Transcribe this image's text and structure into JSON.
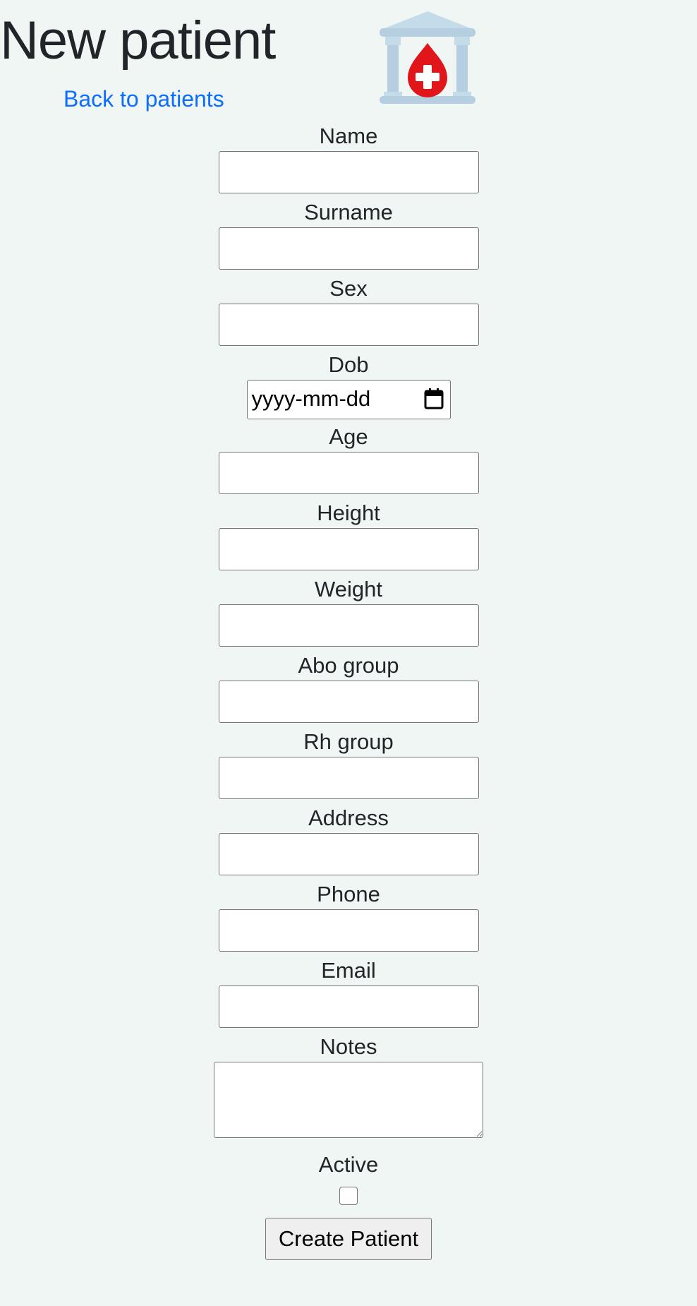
{
  "header": {
    "title": "New patient",
    "back_link": "Back to patients",
    "logo_icon": "blood-bank-icon"
  },
  "form": {
    "fields": [
      {
        "label": "Name",
        "value": ""
      },
      {
        "label": "Surname",
        "value": ""
      },
      {
        "label": "Sex",
        "value": ""
      },
      {
        "label": "Dob",
        "placeholder": "yyyy-mm-dd"
      },
      {
        "label": "Age",
        "value": ""
      },
      {
        "label": "Height",
        "value": ""
      },
      {
        "label": "Weight",
        "value": ""
      },
      {
        "label": "Abo group",
        "value": ""
      },
      {
        "label": "Rh group",
        "value": ""
      },
      {
        "label": "Address",
        "value": ""
      },
      {
        "label": "Phone",
        "value": ""
      },
      {
        "label": "Email",
        "value": ""
      },
      {
        "label": "Notes",
        "value": ""
      }
    ],
    "active": {
      "label": "Active",
      "checked": false
    },
    "submit_label": "Create Patient"
  },
  "colors": {
    "background": "#f0f6f4",
    "link": "#0d6efd",
    "logo_red": "#e0161b",
    "logo_blue": "#b6cfe0"
  }
}
